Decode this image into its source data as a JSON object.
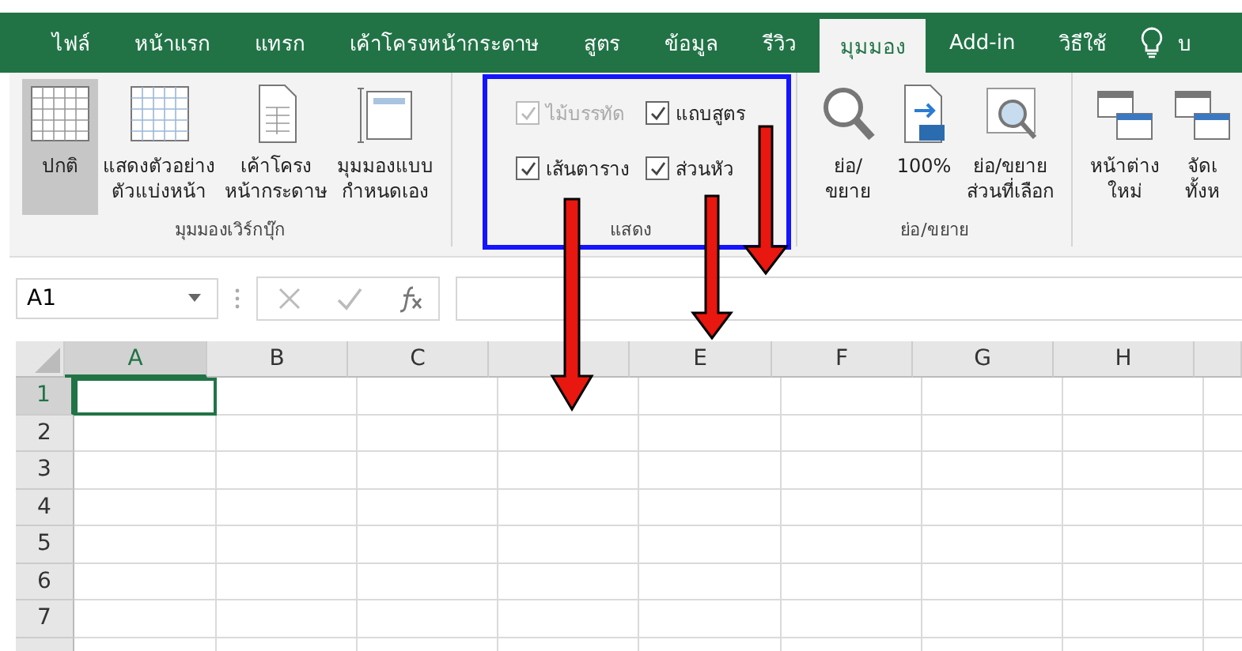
{
  "tabs": [
    {
      "label": "ไฟล์",
      "selected": false
    },
    {
      "label": "หน้าแรก",
      "selected": false
    },
    {
      "label": "แทรก",
      "selected": false
    },
    {
      "label": "เค้าโครงหน้ากระดาษ",
      "selected": false
    },
    {
      "label": "สูตร",
      "selected": false
    },
    {
      "label": "ข้อมูล",
      "selected": false
    },
    {
      "label": "รีวิว",
      "selected": false
    },
    {
      "label": "มุมมอง",
      "selected": true
    },
    {
      "label": "Add-in",
      "selected": false
    },
    {
      "label": "วิธีใช้",
      "selected": false
    }
  ],
  "tell_me": {
    "text": "บ"
  },
  "ribbon": {
    "groups": [
      {
        "kind": "buttons",
        "label": "มุมมองเวิร์กบุ๊ก",
        "items": [
          {
            "kind": "normal",
            "label": "ปกติ",
            "selected": true
          },
          {
            "kind": "pagebreak",
            "label": "แสดงตัวอย่าง\nตัวแบ่งหน้า",
            "selected": false
          },
          {
            "kind": "pagelayout",
            "label": "เค้าโครง\nหน้ากระดาษ",
            "selected": false
          },
          {
            "kind": "custom",
            "label": "มุมมองแบบ\nกำหนดเอง",
            "selected": false
          }
        ]
      },
      {
        "kind": "checks",
        "label": "แสดง",
        "items": [
          {
            "label": "ไม้บรรทัด",
            "checked": true,
            "disabled": true
          },
          {
            "label": "แถบสูตร",
            "checked": true,
            "disabled": false
          },
          {
            "label": "เส้นตาราง",
            "checked": true,
            "disabled": false
          },
          {
            "label": "ส่วนหัว",
            "checked": true,
            "disabled": false
          }
        ]
      },
      {
        "kind": "buttons",
        "label": "ย่อ/ขยาย",
        "items": [
          {
            "kind": "zoom",
            "label": "ย่อ/\nขยาย",
            "selected": false
          },
          {
            "kind": "zoom100",
            "label": "100%",
            "selected": false
          },
          {
            "kind": "zoomsel",
            "label": "ย่อ/ขยาย\nส่วนที่เลือก",
            "selected": false
          }
        ]
      },
      {
        "kind": "buttons",
        "items": [
          {
            "kind": "newwindow",
            "label": "หน้าต่าง\nใหม่",
            "selected": false
          },
          {
            "kind": "arrange",
            "label": "จัดเ\nทั้งห",
            "selected": false
          }
        ]
      }
    ]
  },
  "formula_bar": {
    "name_box": "A1"
  },
  "sheet": {
    "columns": [
      {
        "label": "A",
        "selected": true
      },
      {
        "label": "B",
        "selected": false
      },
      {
        "label": "C",
        "selected": false
      },
      {
        "selected": false
      },
      {
        "label": "E",
        "selected": false
      },
      {
        "label": "F",
        "selected": false
      },
      {
        "label": "G",
        "selected": false
      },
      {
        "label": "H",
        "selected": false
      },
      {
        "selected": false
      }
    ],
    "rows": [
      {
        "label": "1",
        "selected": true
      },
      {
        "label": "2",
        "selected": false
      },
      {
        "label": "3",
        "selected": false
      },
      {
        "label": "4",
        "selected": false
      },
      {
        "label": "5",
        "selected": false
      },
      {
        "label": "6",
        "selected": false
      },
      {
        "label": "7",
        "selected": false
      }
    ]
  }
}
